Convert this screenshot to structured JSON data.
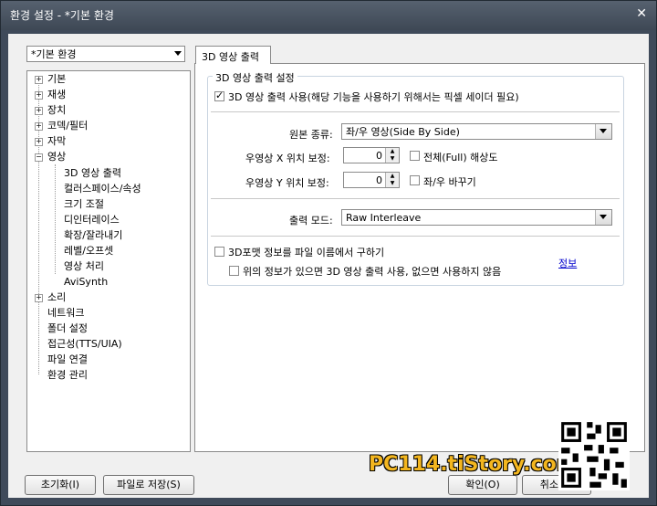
{
  "window": {
    "title": "환경 설정 - *기본 환경",
    "close_glyph": "✕"
  },
  "profile_combo": {
    "value": "*기본 환경"
  },
  "tree": {
    "items": [
      {
        "label": "기본"
      },
      {
        "label": "재생"
      },
      {
        "label": "장치"
      },
      {
        "label": "코덱/필터"
      },
      {
        "label": "자막"
      },
      {
        "label": "영상"
      },
      {
        "label": "3D 영상 출력"
      },
      {
        "label": "컬러스페이스/속성"
      },
      {
        "label": "크기 조절"
      },
      {
        "label": "디인터레이스"
      },
      {
        "label": "확장/잘라내기"
      },
      {
        "label": "레벨/오프셋"
      },
      {
        "label": "영상 처리"
      },
      {
        "label": "AviSynth"
      },
      {
        "label": "소리"
      },
      {
        "label": "네트워크"
      },
      {
        "label": "폴더 설정"
      },
      {
        "label": "접근성(TTS/UIA)"
      },
      {
        "label": "파일 연결"
      },
      {
        "label": "환경 관리"
      }
    ]
  },
  "tab": {
    "label": "3D 영상 출력"
  },
  "group": {
    "title": "3D 영상 출력 설정",
    "enable_label": "3D 영상 출력 사용(해당 기능을 사용하기 위해서는 픽셀 세이더 필요)",
    "source_label": "원본 종류:",
    "source_value": "좌/우 영상(Side By Side)",
    "right_x_label": "우영상 X 위치 보정:",
    "right_x_value": "0",
    "fullres_label": "전체(Full) 해상도",
    "right_y_label": "우영상 Y 위치 보정:",
    "right_y_value": "0",
    "swap_label": "좌/우 바꾸기",
    "output_label": "출력 모드:",
    "output_value": "Raw Interleave",
    "filename_label": "3D포맷 정보를 파일 이름에서 구하기",
    "info_label": "위의 정보가 있으면 3D 영상 출력 사용, 없으면 사용하지 않음",
    "info_link": "정보"
  },
  "buttons": {
    "reset": "초기화(I)",
    "save_file": "파일로 저장(S)",
    "ok": "확인(O)",
    "cancel": "취소(C)"
  },
  "watermark": "PC114.tiStory.com",
  "colors": {
    "title_bar": "#3e4855",
    "link": "#0000cc",
    "watermark": "#f3b61f"
  }
}
